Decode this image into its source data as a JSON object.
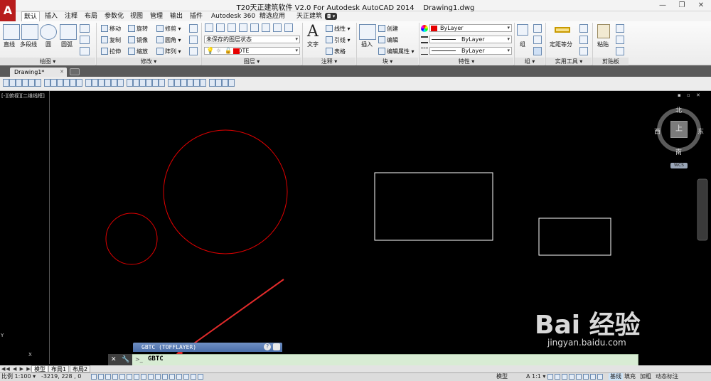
{
  "window": {
    "title": "T20天正建筑软件 V2.0 For Autodesk AutoCAD 2014    Drawing1.dwg",
    "logo": "A",
    "minimize": "—",
    "restore": "❐",
    "close": "✕"
  },
  "menu": {
    "tabs": [
      "默认",
      "插入",
      "注释",
      "布局",
      "参数化",
      "视图",
      "管理",
      "输出",
      "插件",
      "Autodesk 360",
      "精选应用",
      "天正建筑"
    ],
    "active_index": 0
  },
  "ribbon": {
    "draw": {
      "title": "绘图 ▾",
      "line": "直线",
      "polyline": "多段线",
      "circle": "圆",
      "arc": "圆弧"
    },
    "modify": {
      "title": "修改 ▾",
      "move": "移动",
      "rotate": "旋转",
      "trim": "修剪 ▾",
      "copy": "复制",
      "mirror": "镜像",
      "fillet": "圆角 ▾",
      "stretch": "拉伸",
      "scale": "缩放",
      "array": "阵列 ▾"
    },
    "layers": {
      "title": "图层 ▾",
      "layer_state": "未保存的图层状态",
      "current_layer": "DOTE",
      "layer_color": "#e60000"
    },
    "annotation": {
      "title": "注释 ▾",
      "text": "文字",
      "linear": "线性 ▾",
      "leader": "引线 ▾",
      "table": "表格"
    },
    "block": {
      "title": "块 ▾",
      "insert": "插入",
      "create": "创建",
      "edit": "编辑",
      "edit_attr": "编辑属性 ▾"
    },
    "properties": {
      "title": "特性 ▾",
      "color": "ByLayer",
      "color_swatch": "#e60000",
      "linetype": "ByLayer",
      "lineweight": "ByLayer"
    },
    "groups": {
      "title": "组 ▾",
      "group": "组"
    },
    "utilities": {
      "title": "实用工具 ▾",
      "measure": "定距等分"
    },
    "clipboard": {
      "title": "剪贴板",
      "paste": "粘贴"
    }
  },
  "doc_tab": {
    "label": "Drawing1*",
    "close": "✕"
  },
  "viewport": {
    "label": "[-][俯视][二维线框]"
  },
  "viewcube": {
    "north": "北",
    "south": "南",
    "west": "西",
    "east": "东",
    "top": "上",
    "wcs": "WCS"
  },
  "command": {
    "history": "GBTC (TOFFLAYER)",
    "input": "GBTC",
    "close": "✕",
    "settings": "🔧",
    "prompt": ">_"
  },
  "layout_tabs": [
    "模型",
    "布局1",
    "布局2"
  ],
  "status": {
    "scale": "比例 1:100 ▾",
    "coords": "-3219, 228  , 0",
    "model": "模型",
    "annot_scale": "A 1:1 ▾",
    "baseline": "基线",
    "fill": "填充",
    "bold": "加粗",
    "dynamic": "动态标注"
  },
  "watermark": {
    "brand": "Bai 经验",
    "url": "jingyan.baidu.com"
  },
  "colors": {
    "canvas": "#000000",
    "circle": "#e00000",
    "rect": "#ffffff",
    "arrow": "#e32b2b"
  }
}
